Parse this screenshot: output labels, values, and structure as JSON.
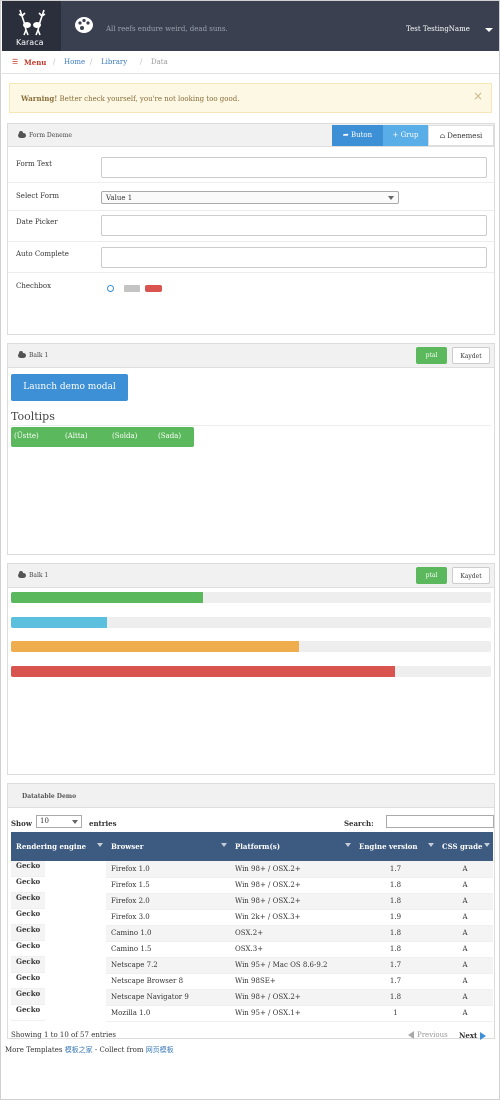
{
  "app": {
    "name": "Karaca",
    "quote": "All reefs endure weird, dead suns.",
    "user": "Test TestingName"
  },
  "breadcrumb": {
    "menu": "Menu",
    "items": [
      "Home",
      "Library",
      "Data"
    ]
  },
  "alert": {
    "strong": "Warning!",
    "text": "Better check yourself, you're not looking too good.",
    "close": "×"
  },
  "form_panel": {
    "title": "Form Deneme",
    "buttons": [
      "Buton",
      "Grup",
      "Denemesi"
    ],
    "rows": {
      "text_label": "Form Text",
      "select_label": "Select Form",
      "select_value": "Value 1",
      "date_label": "Date Picker",
      "auto_label": "Auto Complete",
      "checkbox_label": "Chechbox"
    }
  },
  "panel2": {
    "title": "Balk 1",
    "btn_green": "ptal",
    "btn_white": "Kaydet",
    "launch": "Launch demo modal",
    "tooltips_title": "Tooltips",
    "tooltips": [
      "(Üstte)",
      "(Altta)",
      "(Solda)",
      "(Sada)"
    ]
  },
  "panel3": {
    "title": "Balk 1",
    "btn_green": "ptal",
    "btn_white": "Kaydet",
    "progress": [
      {
        "value": 40,
        "color": "#5cb85c"
      },
      {
        "value": 20,
        "color": "#5bc0de"
      },
      {
        "value": 60,
        "color": "#f0ad4e"
      },
      {
        "value": 80,
        "color": "#d9534f"
      }
    ]
  },
  "datatable": {
    "title": "Datatable Demo",
    "show_label": "Show",
    "show_value": "10",
    "entries_label": "entries",
    "search_label": "Search:",
    "headers": [
      "Rendering engine",
      "Browser",
      "Platform(s)",
      "Engine version",
      "CSS grade"
    ],
    "rows": [
      [
        "Gecko",
        "Firefox 1.0",
        "Win 98+ / OSX.2+",
        "1.7",
        "A"
      ],
      [
        "Gecko",
        "Firefox 1.5",
        "Win 98+ / OSX.2+",
        "1.8",
        "A"
      ],
      [
        "Gecko",
        "Firefox 2.0",
        "Win 98+ / OSX.2+",
        "1.8",
        "A"
      ],
      [
        "Gecko",
        "Firefox 3.0",
        "Win 2k+ / OSX.3+",
        "1.9",
        "A"
      ],
      [
        "Gecko",
        "Camino 1.0",
        "OSX.2+",
        "1.8",
        "A"
      ],
      [
        "Gecko",
        "Camino 1.5",
        "OSX.3+",
        "1.8",
        "A"
      ],
      [
        "Gecko",
        "Netscape 7.2",
        "Win 95+ / Mac OS 8.6-9.2",
        "1.7",
        "A"
      ],
      [
        "Gecko",
        "Netscape Browser 8",
        "Win 98SE+",
        "1.7",
        "A"
      ],
      [
        "Gecko",
        "Netscape Navigator 9",
        "Win 98+ / OSX.2+",
        "1.8",
        "A"
      ],
      [
        "Gecko",
        "Mozilla 1.0",
        "Win 95+ / OSX.1+",
        "1",
        "A"
      ]
    ],
    "info": "Showing 1 to 10 of 57 entries",
    "prev": "Previous",
    "next": "Next"
  },
  "footer": {
    "prefix": "More Templates",
    "link1": "模板之家",
    "middle": "- Collect from",
    "link2": "网页模板"
  }
}
